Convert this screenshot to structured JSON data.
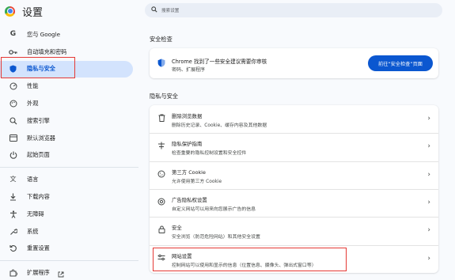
{
  "brand": {
    "title": "设置"
  },
  "sidebar": {
    "items": [
      {
        "label": "您与 Google",
        "icon": "google-icon"
      },
      {
        "label": "自动填充和密码",
        "icon": "key-icon"
      },
      {
        "label": "隐私与安全",
        "icon": "shield-icon",
        "active": true
      },
      {
        "label": "性能",
        "icon": "speedometer-icon"
      },
      {
        "label": "外观",
        "icon": "palette-icon"
      },
      {
        "label": "搜索引擎",
        "icon": "search-icon"
      },
      {
        "label": "默认浏览器",
        "icon": "browser-icon"
      },
      {
        "label": "起始页面",
        "icon": "power-icon"
      },
      {
        "label": "语言",
        "icon": "translate-icon"
      },
      {
        "label": "下载内容",
        "icon": "download-icon"
      },
      {
        "label": "无障碍",
        "icon": "accessibility-icon"
      },
      {
        "label": "系统",
        "icon": "wrench-icon"
      },
      {
        "label": "重置设置",
        "icon": "reset-icon"
      },
      {
        "label": "扩展程序",
        "icon": "puzzle-icon",
        "external_icon": "open-external-icon"
      }
    ]
  },
  "search": {
    "placeholder": "搜索设置"
  },
  "safety_check": {
    "section_title": "安全检查",
    "title": "Chrome 找到了一些安全建议需要你审核",
    "subtitle": "密码、扩展程序",
    "button": "前往“安全检查”页面"
  },
  "privacy": {
    "section_title": "隐私与安全",
    "rows": [
      {
        "title": "删除浏览数据",
        "subtitle": "删除历史记录、Cookie、缓存内容及其他数据",
        "icon": "trash-icon"
      },
      {
        "title": "隐私保护指南",
        "subtitle": "检查重要的隐私控制设置和安全控件",
        "icon": "guide-icon"
      },
      {
        "title": "第三方 Cookie",
        "subtitle": "允许使用第三方 Cookie",
        "icon": "cookie-icon"
      },
      {
        "title": "广告隐私权设置",
        "subtitle": "自定义网站可以用来向您展示广告的信息",
        "icon": "ad-privacy-icon"
      },
      {
        "title": "安全",
        "subtitle": "安全浏览（防范危险网站）和其他安全设置",
        "icon": "lock-icon"
      },
      {
        "title": "网站设置",
        "subtitle": "控制网站可以使用和显示的信息（位置信息、摄像头、弹出式窗口等）",
        "icon": "sliders-icon"
      }
    ]
  },
  "colors": {
    "accent": "#0b57d0",
    "highlight_box": "#e53935",
    "active_bg": "#d3e3fd"
  }
}
